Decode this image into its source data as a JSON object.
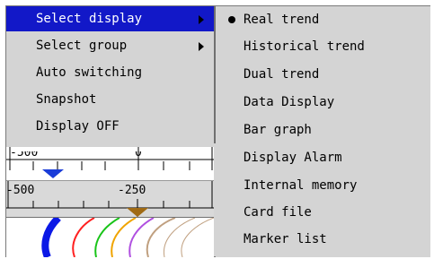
{
  "main_menu": {
    "items": [
      {
        "label": "Select display",
        "has_submenu": true,
        "selected": true
      },
      {
        "label": "Select group",
        "has_submenu": true,
        "selected": false
      },
      {
        "label": "Auto switching",
        "has_submenu": false,
        "selected": false
      },
      {
        "label": "Snapshot",
        "has_submenu": false,
        "selected": false
      },
      {
        "label": "Display OFF",
        "has_submenu": false,
        "selected": false
      }
    ]
  },
  "submenu": {
    "items": [
      {
        "label": "Real trend",
        "checked": true
      },
      {
        "label": "Historical trend",
        "checked": false
      },
      {
        "label": "Dual trend",
        "checked": false
      },
      {
        "label": "Data Display",
        "checked": false
      },
      {
        "label": "Bar graph",
        "checked": false
      },
      {
        "label": "Display Alarm",
        "checked": false
      },
      {
        "label": "Internal memory",
        "checked": false
      },
      {
        "label": "Card file",
        "checked": false
      },
      {
        "label": "Marker list",
        "checked": false
      }
    ]
  },
  "trend_background": {
    "scale_top": {
      "left_label": "-500",
      "center_label": "0",
      "marker_color": "#1a3cd8"
    },
    "scale_bottom": {
      "left_label": "-500",
      "center_label": "-250",
      "marker_color": "#a06a14"
    },
    "pen_colors": [
      "#0b18e6",
      "#ff2020",
      "#19c419",
      "#f0a400",
      "#b050e0",
      "#c0a080"
    ]
  },
  "colors": {
    "menu_bg": "#d4d4d4",
    "highlight": "#1218c8"
  }
}
